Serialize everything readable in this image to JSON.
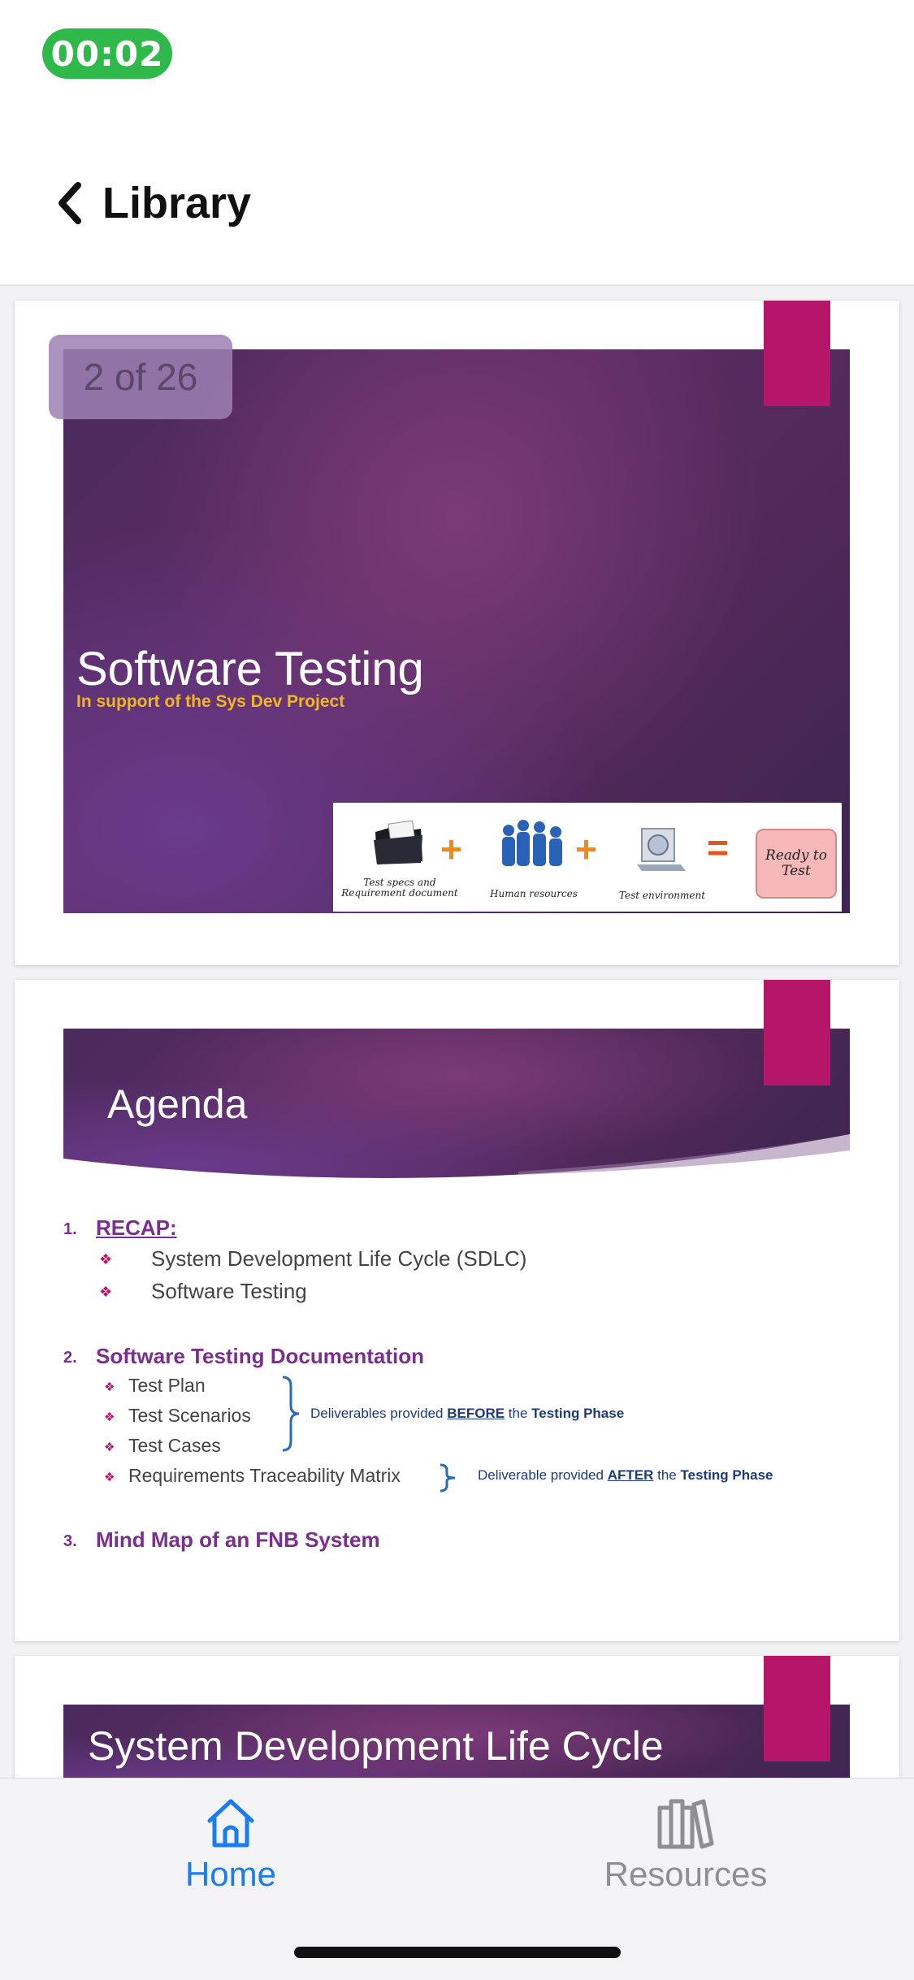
{
  "status_bar": {
    "timer": "00:02",
    "timer_color": "#2fb94a"
  },
  "nav": {
    "back_label": "Library"
  },
  "reader": {
    "page_indicator": "2 of 26",
    "slides": [
      {
        "title": "Software Testing",
        "subtitle": "In support of the Sys Dev Project",
        "equation": {
          "item1": "Test specs and Requirement document",
          "item2": "Human resources",
          "item3": "Test environment",
          "result": "Ready to Test",
          "plus": "+",
          "equals": "="
        }
      },
      {
        "title": "Agenda",
        "sections": [
          {
            "number": "1.",
            "title": "RECAP:",
            "items": [
              "System Development Life Cycle (SDLC)",
              "Software Testing"
            ]
          },
          {
            "number": "2.",
            "title": "Software Testing Documentation",
            "items": [
              "Test Plan",
              "Test Scenarios",
              "Test Cases",
              "Requirements Traceability Matrix"
            ]
          },
          {
            "number": "3.",
            "title": "Mind Map of an FNB System"
          }
        ],
        "notes": {
          "before": {
            "prefix": "Deliverables provided",
            "keyword": "BEFORE",
            "mid": "the",
            "phase": "Testing Phase"
          },
          "after": {
            "prefix": "Deliverable provided",
            "keyword": "AFTER",
            "mid": "the",
            "phase": "Testing Phase"
          }
        }
      },
      {
        "title": "System Development Life Cycle"
      }
    ]
  },
  "tabs": [
    {
      "label": "Home",
      "icon": "home-icon",
      "active": true,
      "color": "#1a7cf0"
    },
    {
      "label": "Resources",
      "icon": "books-icon",
      "active": false,
      "color": "#8e8e93"
    }
  ],
  "colors": {
    "accent_magenta": "#b5166a",
    "slide_purple": "#5c2c62",
    "section_purple": "#7a2f8e"
  }
}
